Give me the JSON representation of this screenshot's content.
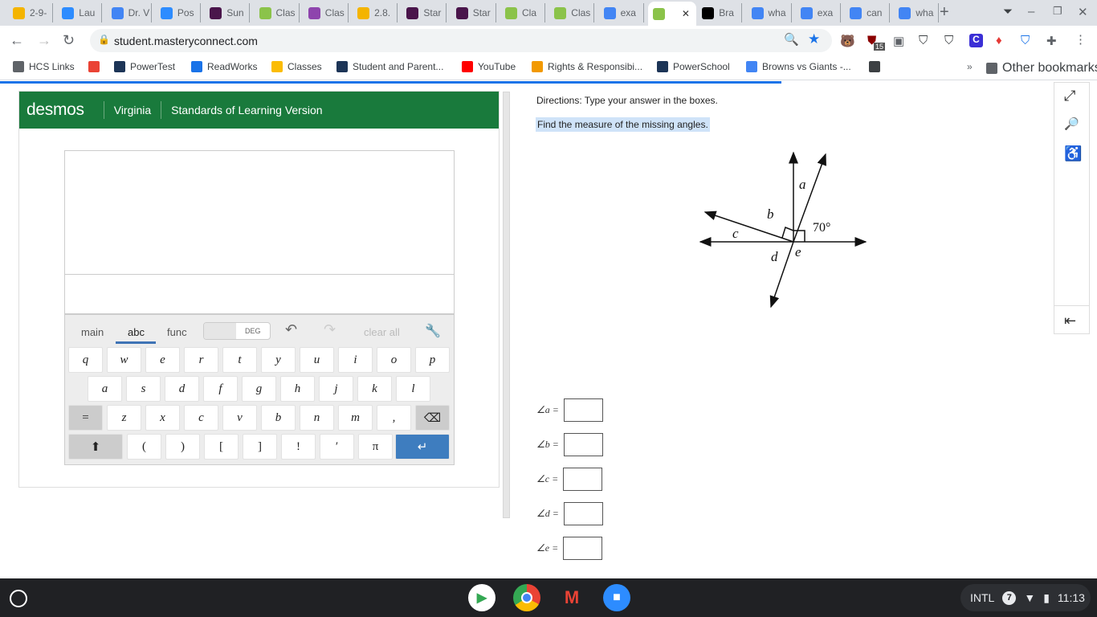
{
  "tabs": [
    {
      "label": "2-9-",
      "color": "#f4b400"
    },
    {
      "label": "Lau",
      "color": "#2d8cff"
    },
    {
      "label": "Dr. V",
      "color": "#4285f4"
    },
    {
      "label": "Pos",
      "color": "#2d8cff"
    },
    {
      "label": "Sun",
      "color": "#4a154b"
    },
    {
      "label": "Clas",
      "color": "#8bc34a"
    },
    {
      "label": "Clas",
      "color": "#8e44ad"
    },
    {
      "label": "2.8.",
      "color": "#f4b400"
    },
    {
      "label": "Star",
      "color": "#4a154b"
    },
    {
      "label": "Star",
      "color": "#4a154b"
    },
    {
      "label": "Cla",
      "color": "#8bc34a"
    },
    {
      "label": "Clas",
      "color": "#8bc34a"
    },
    {
      "label": "exa",
      "color": "#4285f4"
    },
    {
      "label": "",
      "color": "#8bc34a"
    },
    {
      "label": "Bra",
      "color": "#000000"
    },
    {
      "label": "wha",
      "color": "#4285f4"
    },
    {
      "label": "exa",
      "color": "#4285f4"
    },
    {
      "label": "can",
      "color": "#4285f4"
    },
    {
      "label": "wha",
      "color": "#4285f4"
    }
  ],
  "url": "student.masteryconnect.com",
  "extension_badge": "15",
  "bookmarks": [
    {
      "label": "HCS Links",
      "color": "#5f6368"
    },
    {
      "label": "",
      "color": "#ea4335"
    },
    {
      "label": "PowerTest",
      "color": "#1d3557"
    },
    {
      "label": "ReadWorks",
      "color": "#1a73e8"
    },
    {
      "label": "Classes",
      "color": "#fbbc04"
    },
    {
      "label": "Student and Parent...",
      "color": "#1d3557"
    },
    {
      "label": "YouTube",
      "color": "#ff0000"
    },
    {
      "label": "Rights & Responsibi...",
      "color": "#f29900"
    },
    {
      "label": "PowerSchool",
      "color": "#1d3557"
    },
    {
      "label": "Browns vs Giants -...",
      "color": "#4285f4"
    },
    {
      "label": "",
      "color": "#3c4043"
    }
  ],
  "other_bookmarks": "Other bookmarks",
  "desmos": {
    "logo": "desmos",
    "region": "Virginia",
    "version": "Standards of Learning Version",
    "tabs": [
      "main",
      "abc",
      "func"
    ],
    "deg": "DEG",
    "clear_all": "clear all",
    "rows": [
      [
        "q",
        "w",
        "e",
        "r",
        "t",
        "y",
        "u",
        "i",
        "o",
        "p"
      ],
      [
        "a",
        "s",
        "d",
        "f",
        "g",
        "h",
        "j",
        "k",
        "l"
      ],
      [
        "=",
        "z",
        "x",
        "c",
        "v",
        "b",
        "n",
        "m",
        ",",
        "⌫"
      ],
      [
        "⬆",
        "(",
        ")",
        "[",
        "]",
        "!",
        "′",
        "π",
        "↵"
      ]
    ]
  },
  "question": {
    "directions": "Directions: Type your answer in the boxes.",
    "prompt": "Find the measure of the missing angles.",
    "diagram": {
      "labels": [
        "a",
        "b",
        "c",
        "d",
        "e"
      ],
      "given": "70°"
    },
    "answers": [
      {
        "label": "∠a =",
        "value": ""
      },
      {
        "label": "∠b =",
        "value": ""
      },
      {
        "label": "∠c =",
        "value": ""
      },
      {
        "label": "∠d =",
        "value": ""
      },
      {
        "label": "∠e =",
        "value": ""
      }
    ]
  },
  "tray": {
    "ime": "INTL",
    "notifications": "7",
    "time": "11:13"
  }
}
